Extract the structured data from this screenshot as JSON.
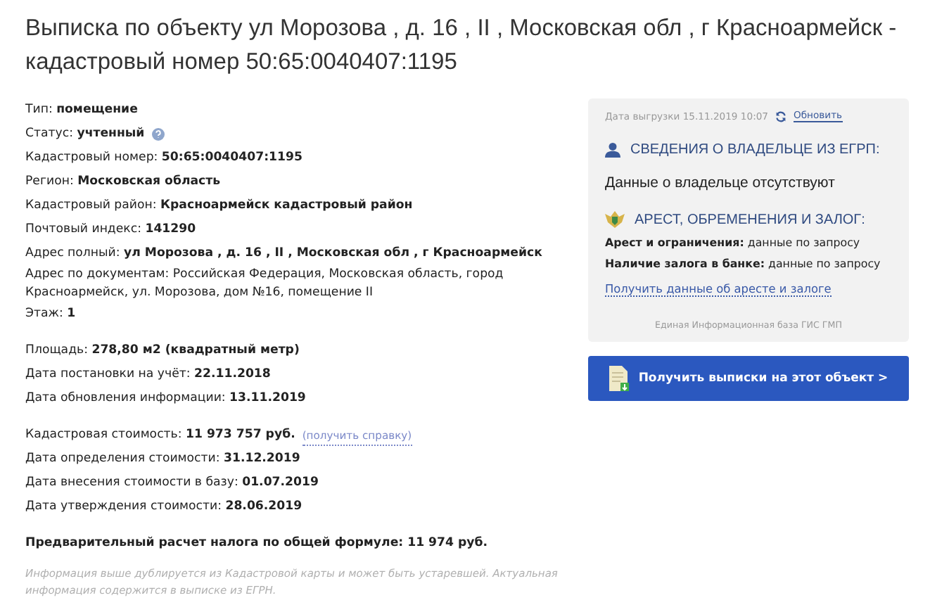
{
  "title": "Выписка по объекту ул Морозова , д. 16 , II , Московская обл , г Красноармейск - кадастровый номер 50:65:0040407:1195",
  "groups": [
    {
      "rows": [
        {
          "label": "Тип:",
          "value": "помещение"
        },
        {
          "label": "Статус:",
          "value": "учтенный",
          "help": true
        },
        {
          "label": "Кадастровый номер:",
          "value": "50:65:0040407:1195"
        },
        {
          "label": "Регион:",
          "value": "Московская область"
        },
        {
          "label": "Кадастровый район:",
          "value": "Красноармейск кадастровый район"
        },
        {
          "label": "Почтовый индекс:",
          "value": "141290"
        },
        {
          "label": "Адрес полный:",
          "value": "ул Морозова , д. 16 , II , Московская обл , г Красноармейск"
        },
        {
          "label": "Адрес по документам: Российская Федерация, Московская область, город Красноармейск, ул. Морозова, дом №16, помещение II"
        },
        {
          "label": "Этаж:",
          "value": "1"
        }
      ]
    },
    {
      "rows": [
        {
          "label": "Площадь:",
          "value": "278,80 м2 (квадратный метр)"
        },
        {
          "label": "Дата постановки на учёт:",
          "value": "22.11.2018"
        },
        {
          "label": "Дата обновления информации:",
          "value": "13.11.2019"
        }
      ]
    },
    {
      "rows": [
        {
          "label": "Кадастровая стоимость:",
          "value": "11 973 757 руб.",
          "link": "(получить справку)"
        },
        {
          "label": "Дата определения стоимости:",
          "value": "31.12.2019"
        },
        {
          "label": "Дата внесения стоимости в базу:",
          "value": "01.07.2019"
        },
        {
          "label": "Дата утверждения стоимости:",
          "value": "28.06.2019"
        }
      ]
    },
    {
      "rows": [
        {
          "value": "Предварительный расчет налога по общей формуле: 11 974 руб."
        }
      ]
    }
  ],
  "note": "Информация выше дублируется из Кадастровой карты и может быть устаревшей. Актуальная информация содержится в выписке из ЕГРН.",
  "panel": {
    "export_date": "Дата выгрузки 15.11.2019 10:07",
    "refresh": "Обновить",
    "owner_heading": "СВЕДЕНИЯ О ВЛАДЕЛЬЦЕ ИЗ ЕГРП:",
    "owner_text": "Данные о владельце отсутствуют",
    "arrest_heading": "АРЕСТ, ОБРЕМЕНЕНИЯ И ЗАЛОГ:",
    "arrest_rows": [
      {
        "label": "Арест и ограничения:",
        "value": "данные по запросу"
      },
      {
        "label": "Наличие залога в банке:",
        "value": "данные по запросу"
      }
    ],
    "arrest_link": "Получить данные об аресте и залоге",
    "source": "Единая Информационная база ГИС ГМП"
  },
  "button": "Получить выписки на этот объект >"
}
